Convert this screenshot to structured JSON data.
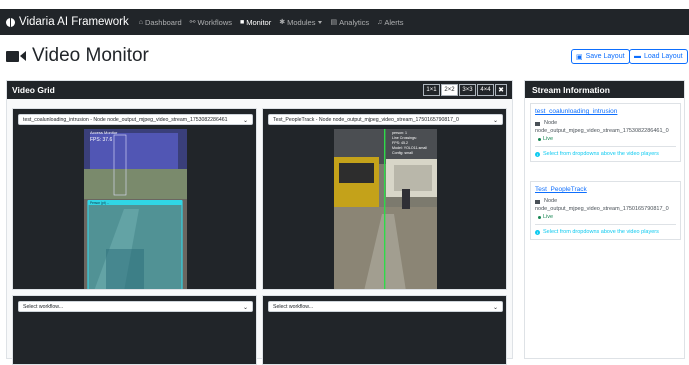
{
  "navbar": {
    "brand": "Vidaria AI Framework",
    "items": [
      {
        "label": "Dashboard",
        "icon": "home-icon",
        "glyph": "⌂",
        "active": false
      },
      {
        "label": "Workflows",
        "icon": "workflow-icon",
        "glyph": "⚯",
        "active": false
      },
      {
        "label": "Monitor",
        "icon": "video-camera-icon",
        "glyph": "▶",
        "active": true
      },
      {
        "label": "Modules",
        "icon": "puzzle-icon",
        "glyph": "✱",
        "active": false,
        "dropdown": true
      },
      {
        "label": "Analytics",
        "icon": "chart-icon",
        "glyph": "▤",
        "active": false
      },
      {
        "label": "Alerts",
        "icon": "bell-icon",
        "glyph": "♫",
        "active": false
      }
    ]
  },
  "page": {
    "title": "Video Monitor",
    "save_label": "Save Layout",
    "load_label": "Load Layout"
  },
  "grid": {
    "title": "Video Grid",
    "layouts": [
      "1×1",
      "2×2",
      "3×3",
      "4×4"
    ],
    "active_layout": "2×2",
    "cells": [
      {
        "select": "test_coalunloading_intrusion - Node node_output_mjpeg_video_stream_1753082286461",
        "has_video": true
      },
      {
        "select": "Test_PeopleTrack - Node node_output_mjpeg_video_stream_1750165790817_0",
        "has_video": true
      },
      {
        "select": "Select workflow...",
        "has_video": false
      },
      {
        "select": "Select workflow...",
        "has_video": false
      }
    ],
    "video1_overlay": {
      "fps": "FPS: 37.6",
      "detection": "Person (pt) ..."
    },
    "video2_overlay": {
      "line1": "person: 1",
      "line2": "Line Crossings:",
      "line3": "FPS: 45.2",
      "line4": "Model: YOLO11-small",
      "line5": "Config: small"
    }
  },
  "streams": {
    "title": "Stream Information",
    "node_label": "Node",
    "live_label": "Live",
    "hint": "Select from dropdowns above the video players",
    "items": [
      {
        "name": "test_coalunloading_intrusion",
        "node_id": "node_output_mjpeg_video_stream_1753082286461_0"
      },
      {
        "name": "Test_PeopleTrack",
        "node_id": "node_output_mjpeg_video_stream_1750165790817_0"
      }
    ]
  }
}
